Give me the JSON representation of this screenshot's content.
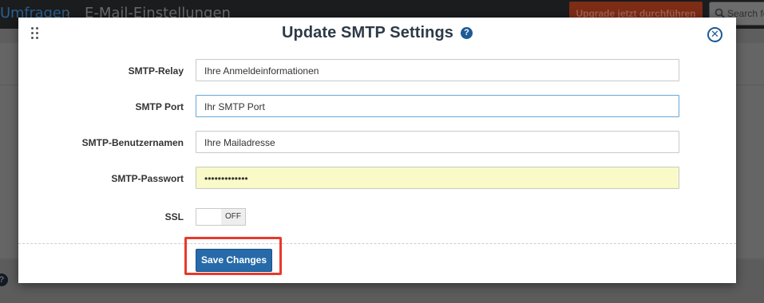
{
  "background": {
    "breadcrumb_parent": "Umfragen",
    "breadcrumb_separator": "›",
    "breadcrumb_current": "E-Mail-Einstellungen",
    "upgrade_label": "Upgrade jetzt durchführen",
    "search_placeholder": "Search fo",
    "help_glyph": "?"
  },
  "modal": {
    "title": "Update SMTP Settings",
    "help_glyph": "?",
    "close_glyph": "✕",
    "fields": [
      {
        "label": "SMTP-Relay",
        "value": "Ihre Anmeldeinformationen"
      },
      {
        "label": "SMTP Port",
        "value": "Ihr SMTP Port"
      },
      {
        "label": "SMTP-Benutzernamen",
        "value": "Ihre Mailadresse"
      },
      {
        "label": "SMTP-Passwort",
        "value": "•••••••••••••"
      }
    ],
    "ssl": {
      "label": "SSL",
      "state": "OFF"
    },
    "save_label": "Save Changes"
  },
  "colors": {
    "primary": "#266aa9",
    "highlight": "#e8392b",
    "autofill": "#fafac8",
    "upgrade": "#7d2c16"
  }
}
